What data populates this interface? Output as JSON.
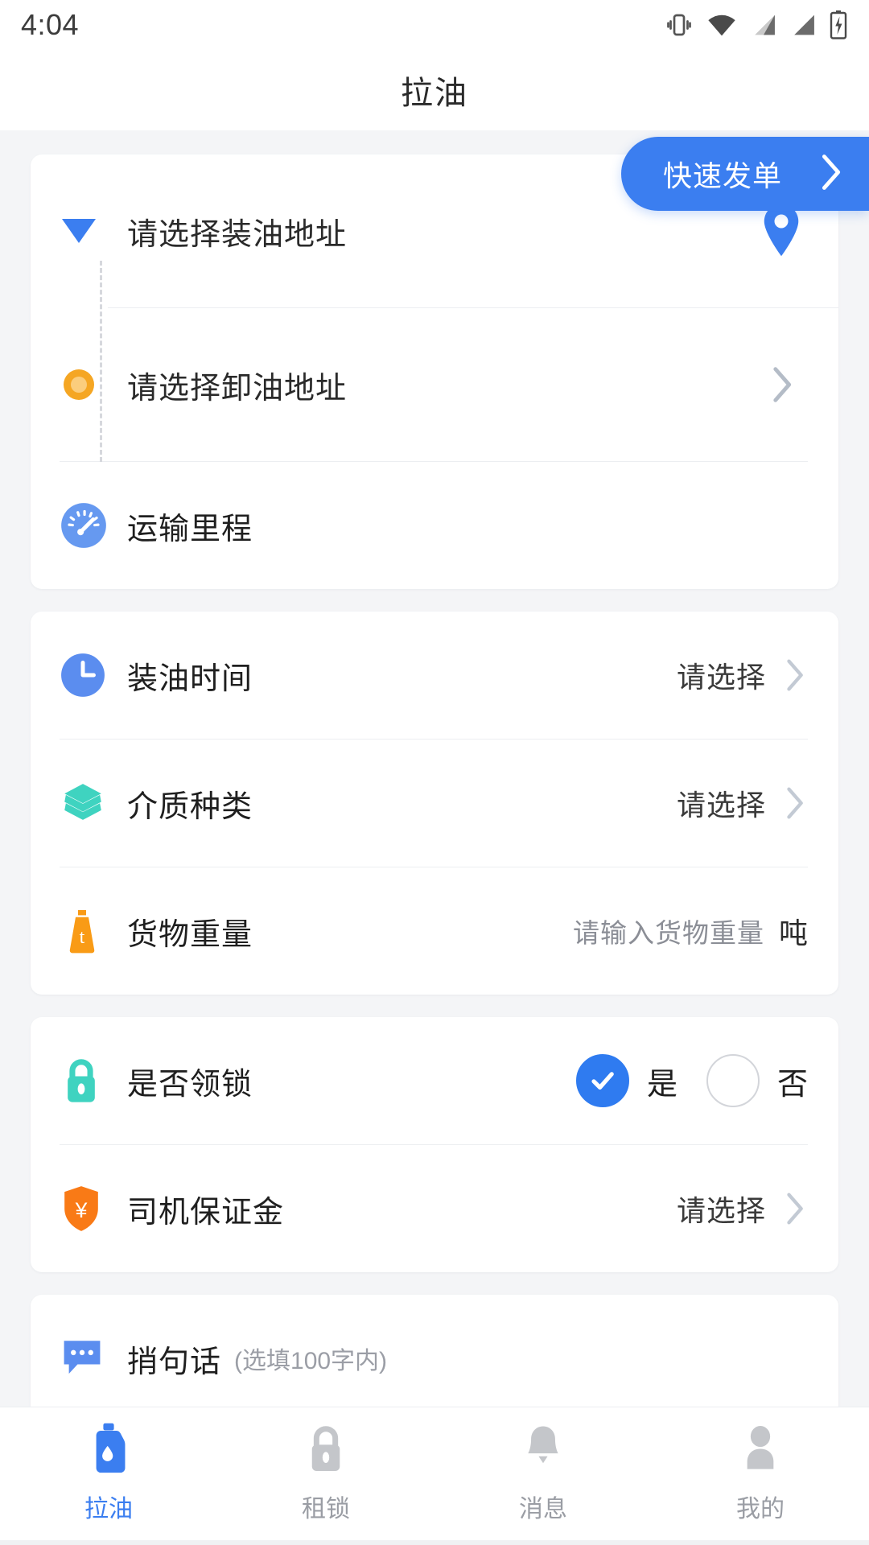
{
  "status_bar": {
    "time": "4:04",
    "icons": [
      "vibrate-icon",
      "wifi-icon",
      "signal-icon",
      "signal-icon",
      "battery-charging-icon"
    ]
  },
  "header": {
    "title": "拉油"
  },
  "quick_order": {
    "label": "快速发单",
    "chevron": "chevron-right-icon",
    "color": "#3b7ef0"
  },
  "address_card": {
    "load": {
      "marker": "triangle-down-marker",
      "text": "请选择装油地址",
      "right_icon": "map-pin-icon",
      "marker_color": "#3b7ef0"
    },
    "unload": {
      "marker": "circle-dot-marker",
      "text": "请选择卸油地址",
      "right_icon": "chevron-right-icon",
      "marker_color": "#f5a623"
    },
    "mileage": {
      "icon": "speedometer-icon",
      "label": "运输里程",
      "icon_color": "#6699f0"
    }
  },
  "detail_card": {
    "rows": [
      {
        "icon": "clock-icon",
        "icon_color": "#6699f0",
        "label": "装油时间",
        "value": "请选择",
        "right_icon": "chevron-right-icon"
      },
      {
        "icon": "layers-icon",
        "icon_color": "#3fd3c0",
        "label": "介质种类",
        "value": "请选择",
        "right_icon": "chevron-right-icon"
      },
      {
        "icon": "weight-icon",
        "icon_color": "#f99b16",
        "label": "货物重量",
        "value": "请输入货物重量",
        "unit": "吨"
      }
    ]
  },
  "lock_card": {
    "lock_row": {
      "icon": "lock-icon",
      "icon_color": "#3fd3c0",
      "label": "是否领锁",
      "options": [
        {
          "label": "是",
          "selected": true
        },
        {
          "label": "否",
          "selected": false
        }
      ],
      "selected_color": "#2f7bf0"
    },
    "deposit_row": {
      "icon": "shield-yuan-icon",
      "icon_color": "#f97a16",
      "label": "司机保证金",
      "value": "请选择",
      "right_icon": "chevron-right-icon"
    }
  },
  "message_card": {
    "icon": "chat-bubble-icon",
    "icon_color": "#5b8def",
    "label": "捎句话",
    "hint": "(选填100字内)"
  },
  "tabbar": {
    "items": [
      {
        "icon": "oil-bottle-icon",
        "label": "拉油",
        "active": true
      },
      {
        "icon": "lock-icon",
        "label": "租锁",
        "active": false
      },
      {
        "icon": "bell-icon",
        "label": "消息",
        "active": false
      },
      {
        "icon": "person-icon",
        "label": "我的",
        "active": false
      }
    ],
    "active_color": "#3b7ef0",
    "inactive_color": "#c4c6ca"
  }
}
